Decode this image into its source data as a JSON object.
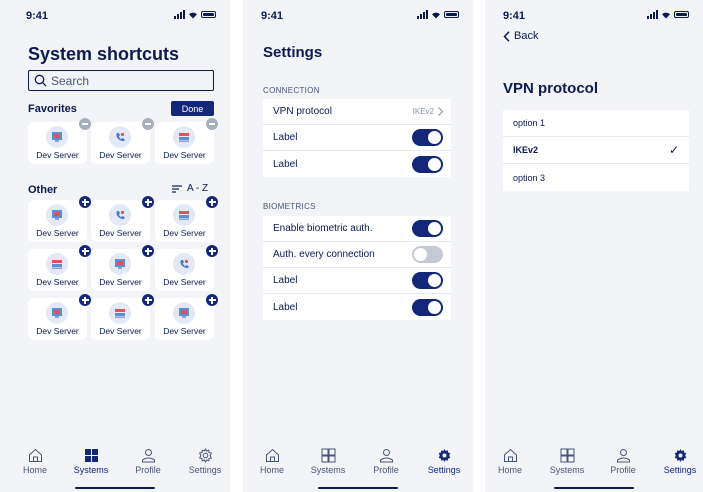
{
  "status_time": "9:41",
  "screen1": {
    "title": "System shortcuts",
    "search_placeholder": "Search",
    "favorites_label": "Favorites",
    "done_label": "Done",
    "other_label": "Other",
    "sort_label": "A - Z",
    "tile_label": "Dev Server",
    "favorites": [
      {
        "label": "Dev Server",
        "icon": "screen-icon"
      },
      {
        "label": "Dev Server",
        "icon": "phone-icon"
      },
      {
        "label": "Dev Server",
        "icon": "server-icon"
      }
    ],
    "other": [
      {
        "label": "Dev Server",
        "icon": "screen-icon"
      },
      {
        "label": "Dev Server",
        "icon": "phone-icon"
      },
      {
        "label": "Dev Server",
        "icon": "server-icon"
      },
      {
        "label": "Dev Server",
        "icon": "server-icon"
      },
      {
        "label": "Dev Server",
        "icon": "screen-icon"
      },
      {
        "label": "Dev Server",
        "icon": "phone-icon"
      },
      {
        "label": "Dev Server",
        "icon": "screen-icon"
      },
      {
        "label": "Dev Server",
        "icon": "server-icon"
      },
      {
        "label": "Dev Server",
        "icon": "screen-icon"
      }
    ]
  },
  "screen2": {
    "title": "Settings",
    "connection_label": "CONNECTION",
    "vpn_protocol_label": "VPN protocol",
    "vpn_protocol_value": "IKEv2",
    "label_1": "Label",
    "label_2": "Label",
    "biometrics_label": "BIOMETRICS",
    "enable_biometric": "Enable biometric auth.",
    "auth_every": "Auth. every connection",
    "label_3": "Label",
    "label_4": "Label"
  },
  "screen3": {
    "back_label": "Back",
    "title": "VPN protocol",
    "options": [
      "option 1",
      "IKEv2",
      "option 3"
    ],
    "selected_index": 1
  },
  "tabs": {
    "home": "Home",
    "systems": "Systems",
    "profile": "Profile",
    "settings": "Settings"
  },
  "colors": {
    "accent": "#14287a",
    "text": "#0c1a4f",
    "background": "#f2f4f8"
  }
}
